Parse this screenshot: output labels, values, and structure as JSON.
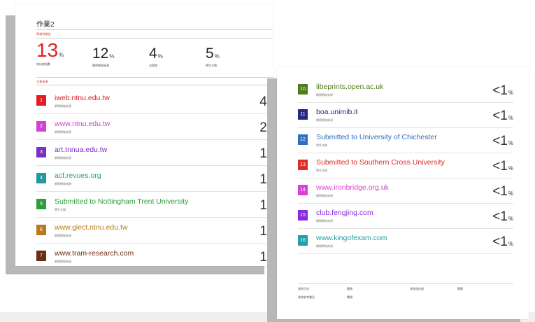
{
  "doc": {
    "title": "作業2"
  },
  "summary": {
    "header": "原創性報告",
    "stats": [
      {
        "value": "13",
        "unit": "%",
        "label": "相似度指數"
      },
      {
        "value": "12",
        "unit": "%",
        "label": "網際網絡來源"
      },
      {
        "value": "4",
        "unit": "%",
        "label": "出版物"
      },
      {
        "value": "5",
        "unit": "%",
        "label": "學生文稿"
      }
    ]
  },
  "sources": {
    "header": "主要來源",
    "items": [
      {
        "num": "1",
        "name": "iweb.ntnu.edu.tw",
        "type": "網際網絡來源",
        "pct": "4",
        "unit": "%",
        "color": "#e31b23"
      },
      {
        "num": "2",
        "name": "www.ntnu.edu.tw",
        "type": "網際網絡來源",
        "pct": "2",
        "unit": "%",
        "color": "#d43fd6"
      },
      {
        "num": "3",
        "name": "art.tnnua.edu.tw",
        "type": "網際網絡來源",
        "pct": "1",
        "unit": "%",
        "color": "#7b2fc7"
      },
      {
        "num": "4",
        "name": "acf.revues.org",
        "type": "網際網絡來源",
        "pct": "1",
        "unit": "%",
        "color": "#1f9aa0"
      },
      {
        "num": "5",
        "name": "Submitted to Nottingham Trent University",
        "type": "學生文稿",
        "pct": "1",
        "unit": "%",
        "color": "#2e9e3b"
      },
      {
        "num": "6",
        "name": "www.giect.ntnu.edu.tw",
        "type": "網際網絡來源",
        "pct": "1",
        "unit": "%",
        "color": "#b97a1c"
      },
      {
        "num": "7",
        "name": "www.tram-research.com",
        "type": "網際網絡來源",
        "pct": "1",
        "unit": "%",
        "color": "#6b2d14"
      },
      {
        "num": "10",
        "name": "libeprints.open.ac.uk",
        "type": "網際網絡來源",
        "pct": "<1",
        "unit": "%",
        "color": "#4f7d1c"
      },
      {
        "num": "11",
        "name": "boa.unimib.it",
        "type": "網際網絡來源",
        "pct": "<1",
        "unit": "%",
        "color": "#26277f"
      },
      {
        "num": "12",
        "name": "Submitted to University of Chichester",
        "type": "學生文稿",
        "pct": "<1",
        "unit": "%",
        "color": "#2e6fbf"
      },
      {
        "num": "13",
        "name": "Submitted to Southern Cross University",
        "type": "學生文稿",
        "pct": "<1",
        "unit": "%",
        "color": "#e02b2b"
      },
      {
        "num": "14",
        "name": "www.ironbridge.org.uk",
        "type": "網際網絡來源",
        "pct": "<1",
        "unit": "%",
        "color": "#dd3fd6"
      },
      {
        "num": "15",
        "name": "club.fengjing.com",
        "type": "網際網絡來源",
        "pct": "<1",
        "unit": "%",
        "color": "#8a2be2"
      },
      {
        "num": "16",
        "name": "www.kingofexam.com",
        "type": "網際網絡來源",
        "pct": "<1",
        "unit": "%",
        "color": "#1ea0a6"
      }
    ]
  },
  "footer": {
    "exclude_quotes_label": "排除引述",
    "exclude_quotes_value": "關閉",
    "exclude_bib_label": "排除參考書目",
    "exclude_bib_value": "關閉",
    "exclude_matches_label": "排除相符處",
    "exclude_matches_value": "關閉"
  }
}
